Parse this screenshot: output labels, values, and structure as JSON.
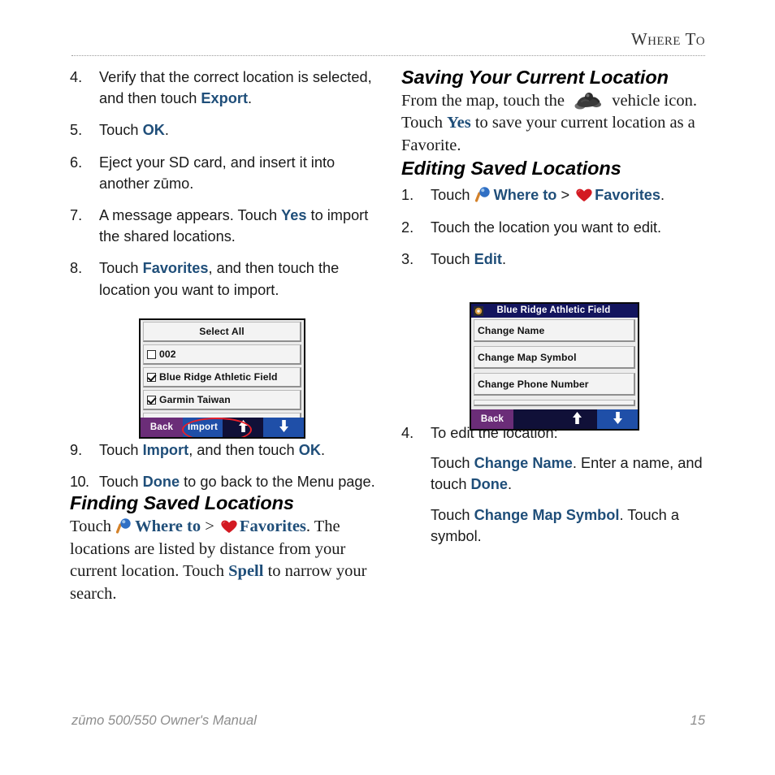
{
  "header": {
    "title_first_letter": "W",
    "title_rest_1": "HERE",
    "title_second_letter": "T",
    "title_rest_2": "O",
    "title_full": "Where To"
  },
  "left_column": {
    "steps": [
      {
        "num": "4.",
        "parts": [
          {
            "type": "text",
            "value": "Verify that the correct location is selected, and then touch "
          },
          {
            "type": "ui",
            "value": "Export"
          },
          {
            "type": "text",
            "value": "."
          }
        ]
      },
      {
        "num": "5.",
        "parts": [
          {
            "type": "text",
            "value": "Touch "
          },
          {
            "type": "ui",
            "value": "OK"
          },
          {
            "type": "text",
            "value": "."
          }
        ]
      },
      {
        "num": "6.",
        "parts": [
          {
            "type": "text",
            "value": "Eject your SD card, and insert it into another zūmo."
          }
        ]
      },
      {
        "num": "7.",
        "parts": [
          {
            "type": "text",
            "value": "A message appears. Touch "
          },
          {
            "type": "ui",
            "value": "Yes"
          },
          {
            "type": "text",
            "value": " to import the shared locations."
          }
        ]
      },
      {
        "num": "8.",
        "parts": [
          {
            "type": "text",
            "value": "Touch "
          },
          {
            "type": "ui",
            "value": "Favorites"
          },
          {
            "type": "text",
            "value": ", and then touch the location you want to import."
          }
        ]
      }
    ],
    "steps_after": [
      {
        "num": "9.",
        "parts": [
          {
            "type": "text",
            "value": "Touch "
          },
          {
            "type": "ui",
            "value": "Import"
          },
          {
            "type": "text",
            "value": ", and then touch "
          },
          {
            "type": "ui",
            "value": "OK"
          },
          {
            "type": "text",
            "value": "."
          }
        ]
      },
      {
        "num": "10.",
        "parts": [
          {
            "type": "text",
            "value": "Touch "
          },
          {
            "type": "ui",
            "value": "Done"
          },
          {
            "type": "text",
            "value": " to go back to the Menu page."
          }
        ]
      }
    ],
    "heading_finding": "Finding Saved Locations",
    "finding_text": {
      "lead": "Touch ",
      "where_to": "Where to",
      "separator": " > ",
      "favorites": "Favorites",
      "after": ". The locations are listed by distance from your current location. Touch ",
      "spell": "Spell",
      "tail": " to narrow your search."
    }
  },
  "right_column": {
    "heading_saving": "Saving Your Current Location",
    "saving_text": {
      "lead": "From the map, touch the ",
      "mid": " vehicle icon. Touch ",
      "yes": "Yes",
      "tail": " to save your current location as a Favorite."
    },
    "heading_editing": "Editing Saved Locations",
    "steps": [
      {
        "num": "1.",
        "lead": "Touch ",
        "where_to": "Where to",
        "separator": " > ",
        "favorites": "Favorites",
        "tail": "."
      },
      {
        "num": "2.",
        "parts": [
          {
            "type": "text",
            "value": "Touch the location you want to edit."
          }
        ]
      },
      {
        "num": "3.",
        "parts": [
          {
            "type": "text",
            "value": "Touch "
          },
          {
            "type": "ui",
            "value": "Edit"
          },
          {
            "type": "text",
            "value": "."
          }
        ]
      }
    ],
    "step4": {
      "num": "4.",
      "text": "To edit the location:",
      "sub1": [
        {
          "type": "text",
          "value": "Touch "
        },
        {
          "type": "ui",
          "value": "Change Name"
        },
        {
          "type": "text",
          "value": ". Enter a name, and touch "
        },
        {
          "type": "ui",
          "value": "Done"
        },
        {
          "type": "text",
          "value": "."
        }
      ],
      "sub2": [
        {
          "type": "text",
          "value": "Touch "
        },
        {
          "type": "ui",
          "value": "Change Map Symbol"
        },
        {
          "type": "text",
          "value": ". Touch a symbol."
        }
      ]
    }
  },
  "device_screenshot_1": {
    "rows": [
      {
        "label": "Select All",
        "checkbox": "none",
        "centered": true
      },
      {
        "label": "002",
        "checkbox": "unchecked",
        "centered": false
      },
      {
        "label": "Blue Ridge Athletic Field",
        "checkbox": "checked",
        "centered": false
      },
      {
        "label": "Garmin Taiwan",
        "checkbox": "checked",
        "centered": false
      }
    ],
    "toolbar": {
      "back": "Back",
      "import": "Import",
      "up_icon": "arrow-up-icon",
      "down_icon": "arrow-down-icon"
    },
    "highlight_color": "#e8202a"
  },
  "device_screenshot_2": {
    "title": "Blue Ridge Athletic Field",
    "title_icon": "map-symbol-icon",
    "rows": [
      {
        "label": "Change Name"
      },
      {
        "label": "Change Map Symbol"
      },
      {
        "label": "Change Phone Number"
      }
    ],
    "toolbar": {
      "back": "Back",
      "up_icon": "arrow-up-icon",
      "down_icon": "arrow-down-icon"
    }
  },
  "footer": {
    "manual": "zūmo 500/550 Owner's Manual",
    "page_number": "15"
  },
  "colors": {
    "accent_blue": "#1f4e79",
    "device_titlebar": "#13155e",
    "device_back_purple": "#6b2d78",
    "device_blue_button": "#1f4fa8",
    "highlight_red": "#e8202a",
    "footer_gray": "#8d8d8d"
  }
}
